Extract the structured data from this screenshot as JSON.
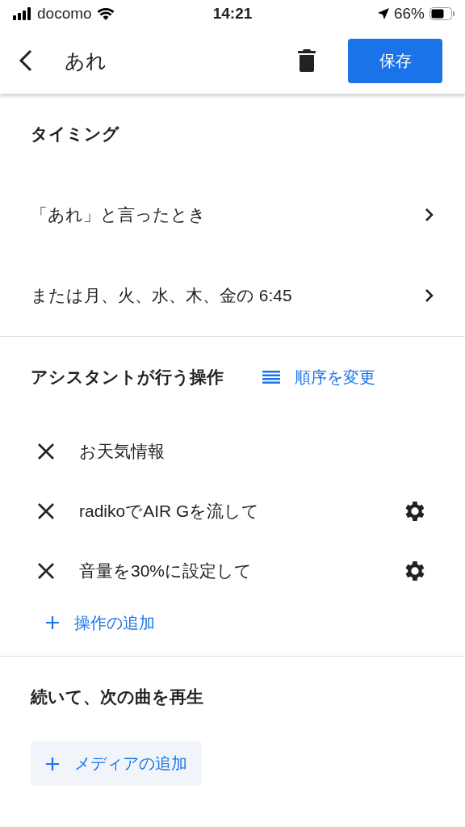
{
  "status_bar": {
    "carrier": "docomo",
    "time": "14:21",
    "battery": "66%"
  },
  "header": {
    "title": "あれ",
    "save": "保存"
  },
  "timing": {
    "title": "タイミング",
    "triggers": [
      {
        "text": "「あれ」と言ったとき"
      },
      {
        "text": "または月、火、水、木、金の 6:45"
      }
    ]
  },
  "actions": {
    "title": "アシスタントが行う操作",
    "reorder": "順序を変更",
    "items": [
      {
        "text": "お天気情報",
        "has_settings": false
      },
      {
        "text": "radikoでAIR Gを流して",
        "has_settings": true
      },
      {
        "text": "音量を30%に設定して",
        "has_settings": true
      }
    ],
    "add": "操作の追加"
  },
  "media": {
    "title": "続いて、次の曲を再生",
    "add": "メディアの追加"
  }
}
